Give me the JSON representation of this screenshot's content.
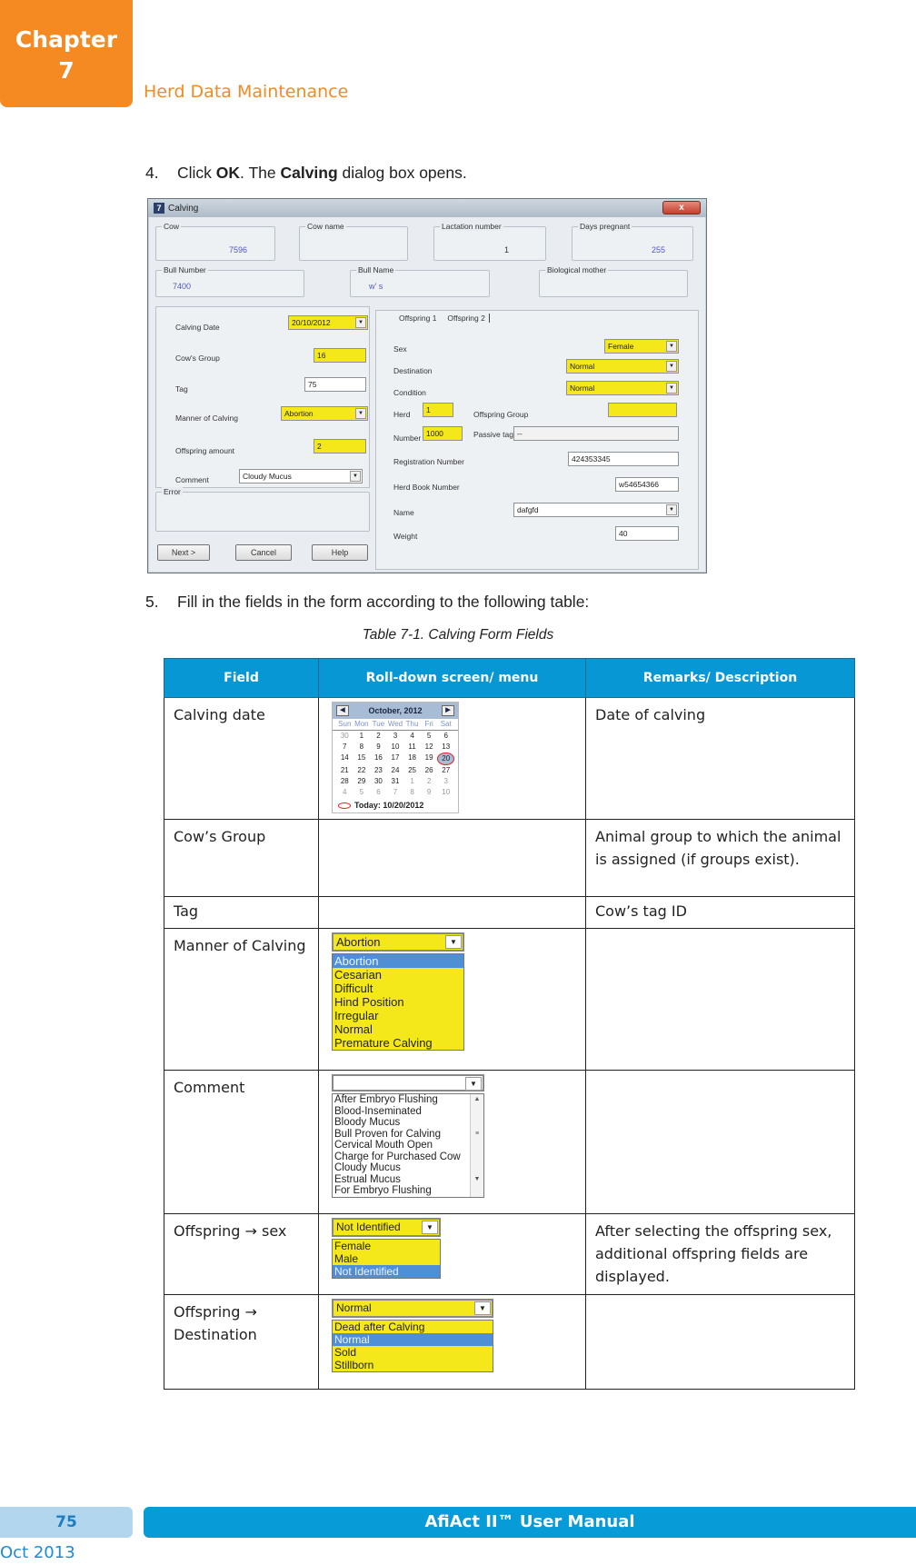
{
  "header": {
    "chapter_label": "Chapter",
    "chapter_number": "7",
    "section_title": "Herd Data Maintenance"
  },
  "steps": {
    "step4": {
      "num": "4.",
      "pre": "Click ",
      "b1": "OK",
      "mid": ". The ",
      "b2": "Calving",
      "post": " dialog box opens."
    },
    "step5": {
      "num": "5.",
      "text": "Fill in the fields in the form according to the following table:"
    }
  },
  "dialog": {
    "title": "Calving",
    "close": "x",
    "groups": {
      "cow": {
        "label": "Cow",
        "value": "7596"
      },
      "cow_name": {
        "label": "Cow name",
        "value": ""
      },
      "lactation": {
        "label": "Lactation number",
        "value": "1"
      },
      "days_pregnant": {
        "label": "Days pregnant",
        "value": "255"
      },
      "bull_number": {
        "label": "Bull Number",
        "value": "7400"
      },
      "bull_name": {
        "label": "Bull Name",
        "value": "w' s"
      },
      "bio_mother": {
        "label": "Biological mother",
        "value": ""
      },
      "error": {
        "label": "Error",
        "value": ""
      }
    },
    "left": {
      "calving_date": {
        "label": "Calving Date",
        "value": "20/10/2012"
      },
      "cows_group": {
        "label": "Cow's Group",
        "value": "16"
      },
      "tag": {
        "label": "Tag",
        "value": "75"
      },
      "manner": {
        "label": "Manner of Calving",
        "value": "Abortion"
      },
      "offspring_amount": {
        "label": "Offspring amount",
        "value": "2"
      },
      "comment": {
        "label": "Comment",
        "value": "Cloudy Mucus"
      }
    },
    "tabs": [
      "Offspring 1",
      "Offspring 2"
    ],
    "right": {
      "sex": {
        "label": "Sex",
        "value": "Female"
      },
      "destination": {
        "label": "Destination",
        "value": "Normal"
      },
      "condition": {
        "label": "Condition",
        "value": "Normal"
      },
      "herd": {
        "label": "Herd",
        "value": "1"
      },
      "offspring_group": {
        "label": "Offspring Group",
        "value": ""
      },
      "number": {
        "label": "Number",
        "value": "1000"
      },
      "passive_tag": {
        "label": "Passive tag",
        "value": "--"
      },
      "registration": {
        "label": "Registration Number",
        "value": "424353345"
      },
      "herd_book": {
        "label": "Herd Book Number",
        "value": "w54654366"
      },
      "name": {
        "label": "Name",
        "value": "dafgfd"
      },
      "weight": {
        "label": "Weight",
        "value": "40"
      }
    },
    "buttons": {
      "next": "Next >",
      "cancel": "Cancel",
      "help": "Help"
    }
  },
  "table": {
    "caption": "Table 7-1. Calving Form Fields",
    "headers": [
      "Field",
      "Roll-down screen/ menu",
      "Remarks/ Description"
    ],
    "rows": [
      {
        "field": "Calving date",
        "remarks": "Date of calving"
      },
      {
        "field": "Cow’s Group",
        "remarks": "Animal group to which the animal is assigned (if groups exist)."
      },
      {
        "field": "Tag",
        "remarks": "Cow’s tag ID"
      },
      {
        "field": "Manner of Calving",
        "remarks": ""
      },
      {
        "field": "Comment",
        "remarks": ""
      },
      {
        "field": "Offspring → sex",
        "remarks": "After selecting the offspring sex, additional offspring fields are displayed."
      },
      {
        "field": "Offspring → Destination",
        "remarks": ""
      }
    ],
    "calendar": {
      "month": "October, 2012",
      "days_of_week": [
        "Sun",
        "Mon",
        "Tue",
        "Wed",
        "Thu",
        "Fri",
        "Sat"
      ],
      "weeks": [
        [
          "30",
          "1",
          "2",
          "3",
          "4",
          "5",
          "6"
        ],
        [
          "7",
          "8",
          "9",
          "10",
          "11",
          "12",
          "13"
        ],
        [
          "14",
          "15",
          "16",
          "17",
          "18",
          "19",
          "20"
        ],
        [
          "21",
          "22",
          "23",
          "24",
          "25",
          "26",
          "27"
        ],
        [
          "28",
          "29",
          "30",
          "31",
          "1",
          "2",
          "3"
        ],
        [
          "4",
          "5",
          "6",
          "7",
          "8",
          "9",
          "10"
        ]
      ],
      "selected": "20",
      "today": "Today: 10/20/2012"
    },
    "manner_dropdown": {
      "value": "Abortion",
      "options": [
        "Abortion",
        "Cesarian",
        "Difficult",
        "Hind Position",
        "Irregular",
        "Normal",
        "Premature Calving"
      ],
      "highlighted": "Abortion"
    },
    "comment_dropdown": {
      "value": "",
      "options": [
        "After Embryo Flushing",
        "Blood-Inseminated",
        "Bloody Mucus",
        "Bull Proven for Calving",
        "Cervical Mouth Open",
        "Charge for Purchased Cow",
        "Cloudy Mucus",
        "Estrual Mucus",
        "For Embryo Flushing"
      ]
    },
    "sex_dropdown": {
      "value": "Not Identified",
      "options": [
        "Female",
        "Male",
        "Not Identified"
      ],
      "highlighted": "Not Identified"
    },
    "destination_dropdown": {
      "value": "Normal",
      "options": [
        "Dead after Calving",
        "Normal",
        "Sold",
        "Stillborn"
      ],
      "highlighted": "Normal"
    }
  },
  "footer": {
    "page": "75",
    "manual": "AfiAct II™ User Manual",
    "date": "Oct 2013"
  }
}
